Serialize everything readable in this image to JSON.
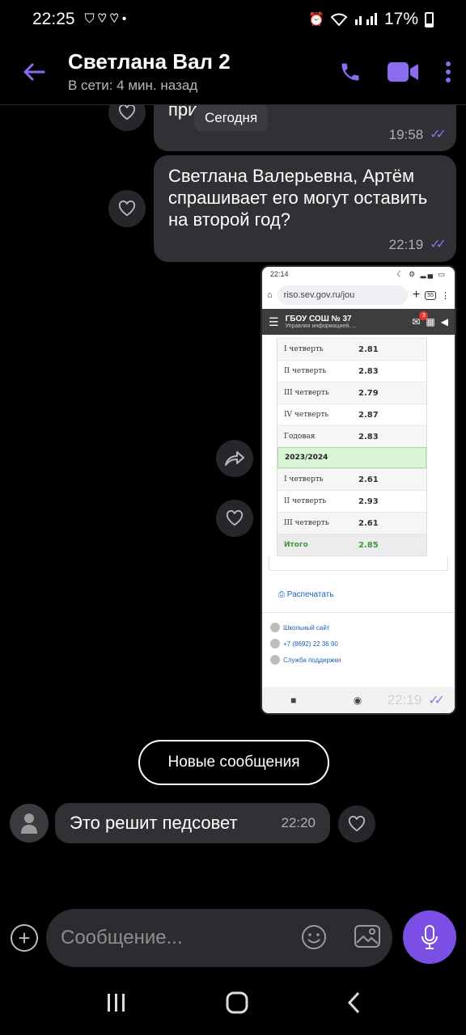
{
  "status_bar": {
    "time": "22:25",
    "battery": "17%"
  },
  "header": {
    "contact_name": "Светлана Вал 2",
    "contact_status": "В сети: 4 мин. назад"
  },
  "messages": {
    "date_chip": "Сегодня",
    "msg1": {
      "text": "приду",
      "time": "19:58"
    },
    "msg2": {
      "text": "Светлана Валерьевна, Артём спрашивает его могут оставить на второй год?",
      "time": "22:19"
    },
    "image_msg": {
      "time": "22:19",
      "phone_time": "22:14",
      "url": "riso.sev.gov.ru/jou",
      "tab_count": "55",
      "notif_count": "3",
      "site_title": "ГБОУ СОШ № 37",
      "site_subtitle": "Управляя информацией, ...",
      "grades_prev": [
        {
          "label": "I четверть",
          "value": "2.81"
        },
        {
          "label": "II четверть",
          "value": "2.83"
        },
        {
          "label": "III четверть",
          "value": "2.79"
        },
        {
          "label": "IV четверть",
          "value": "2.87"
        },
        {
          "label": "Годовая",
          "value": "2.83"
        }
      ],
      "year": "2023/2024",
      "grades_cur": [
        {
          "label": "I четверть",
          "value": "2.61"
        },
        {
          "label": "II четверть",
          "value": "2.93"
        },
        {
          "label": "III четверть",
          "value": "2.61"
        }
      ],
      "total": {
        "label": "Итого",
        "value": "2.85"
      },
      "print_label": "Распечатать",
      "links": [
        "Школьный сайт",
        "+7 (8692) 22 36 90",
        "Служба поддержки"
      ]
    },
    "new_messages_label": "Новые сообщения",
    "incoming": {
      "text": "Это  решит педсовет",
      "time": "22:20"
    }
  },
  "composer": {
    "placeholder": "Сообщение..."
  },
  "colors": {
    "accent": "#7b4fe6",
    "ticks": "#8b78e6",
    "bubble": "#303134"
  }
}
